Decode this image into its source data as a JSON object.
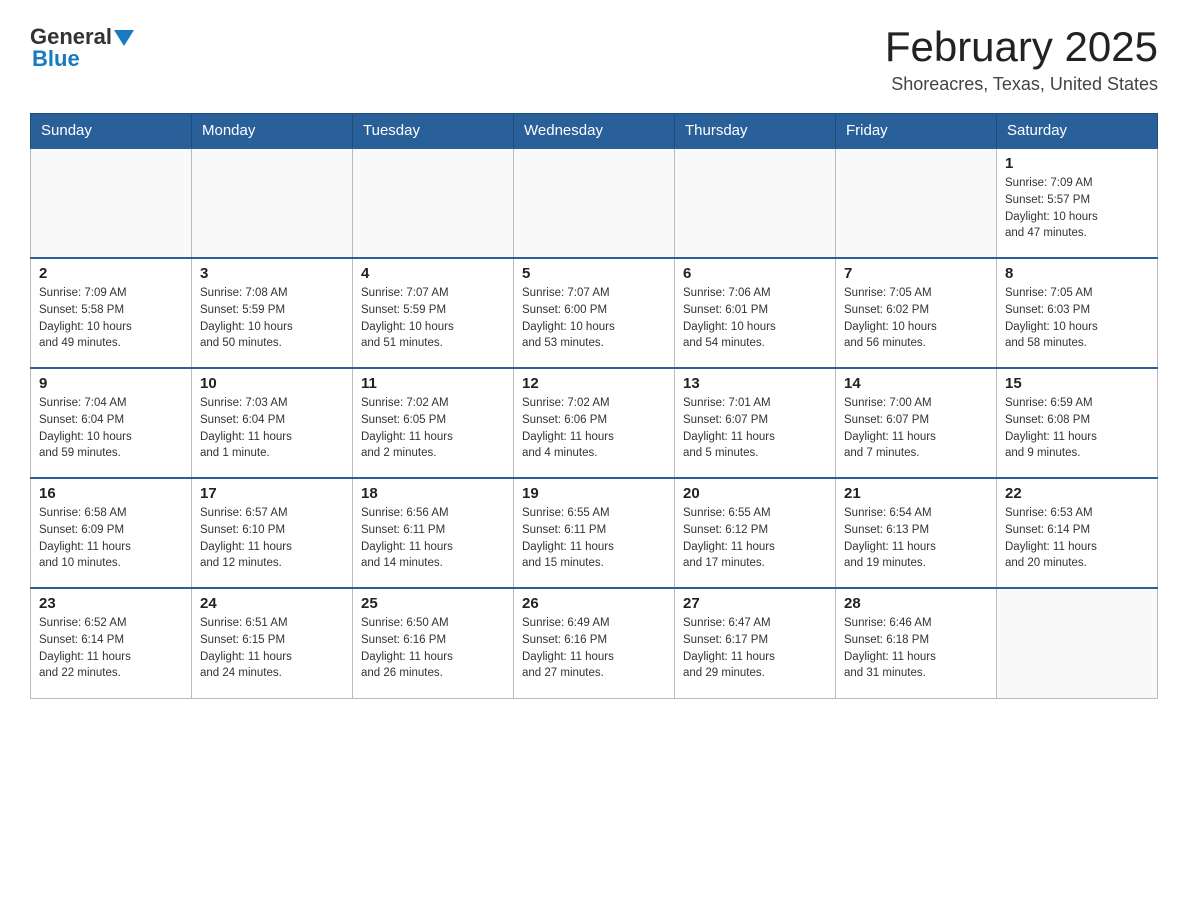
{
  "logo": {
    "text_general": "General",
    "text_blue": "Blue"
  },
  "header": {
    "title": "February 2025",
    "location": "Shoreacres, Texas, United States"
  },
  "weekdays": [
    "Sunday",
    "Monday",
    "Tuesday",
    "Wednesday",
    "Thursday",
    "Friday",
    "Saturday"
  ],
  "weeks": [
    [
      {
        "day": "",
        "info": ""
      },
      {
        "day": "",
        "info": ""
      },
      {
        "day": "",
        "info": ""
      },
      {
        "day": "",
        "info": ""
      },
      {
        "day": "",
        "info": ""
      },
      {
        "day": "",
        "info": ""
      },
      {
        "day": "1",
        "info": "Sunrise: 7:09 AM\nSunset: 5:57 PM\nDaylight: 10 hours\nand 47 minutes."
      }
    ],
    [
      {
        "day": "2",
        "info": "Sunrise: 7:09 AM\nSunset: 5:58 PM\nDaylight: 10 hours\nand 49 minutes."
      },
      {
        "day": "3",
        "info": "Sunrise: 7:08 AM\nSunset: 5:59 PM\nDaylight: 10 hours\nand 50 minutes."
      },
      {
        "day": "4",
        "info": "Sunrise: 7:07 AM\nSunset: 5:59 PM\nDaylight: 10 hours\nand 51 minutes."
      },
      {
        "day": "5",
        "info": "Sunrise: 7:07 AM\nSunset: 6:00 PM\nDaylight: 10 hours\nand 53 minutes."
      },
      {
        "day": "6",
        "info": "Sunrise: 7:06 AM\nSunset: 6:01 PM\nDaylight: 10 hours\nand 54 minutes."
      },
      {
        "day": "7",
        "info": "Sunrise: 7:05 AM\nSunset: 6:02 PM\nDaylight: 10 hours\nand 56 minutes."
      },
      {
        "day": "8",
        "info": "Sunrise: 7:05 AM\nSunset: 6:03 PM\nDaylight: 10 hours\nand 58 minutes."
      }
    ],
    [
      {
        "day": "9",
        "info": "Sunrise: 7:04 AM\nSunset: 6:04 PM\nDaylight: 10 hours\nand 59 minutes."
      },
      {
        "day": "10",
        "info": "Sunrise: 7:03 AM\nSunset: 6:04 PM\nDaylight: 11 hours\nand 1 minute."
      },
      {
        "day": "11",
        "info": "Sunrise: 7:02 AM\nSunset: 6:05 PM\nDaylight: 11 hours\nand 2 minutes."
      },
      {
        "day": "12",
        "info": "Sunrise: 7:02 AM\nSunset: 6:06 PM\nDaylight: 11 hours\nand 4 minutes."
      },
      {
        "day": "13",
        "info": "Sunrise: 7:01 AM\nSunset: 6:07 PM\nDaylight: 11 hours\nand 5 minutes."
      },
      {
        "day": "14",
        "info": "Sunrise: 7:00 AM\nSunset: 6:07 PM\nDaylight: 11 hours\nand 7 minutes."
      },
      {
        "day": "15",
        "info": "Sunrise: 6:59 AM\nSunset: 6:08 PM\nDaylight: 11 hours\nand 9 minutes."
      }
    ],
    [
      {
        "day": "16",
        "info": "Sunrise: 6:58 AM\nSunset: 6:09 PM\nDaylight: 11 hours\nand 10 minutes."
      },
      {
        "day": "17",
        "info": "Sunrise: 6:57 AM\nSunset: 6:10 PM\nDaylight: 11 hours\nand 12 minutes."
      },
      {
        "day": "18",
        "info": "Sunrise: 6:56 AM\nSunset: 6:11 PM\nDaylight: 11 hours\nand 14 minutes."
      },
      {
        "day": "19",
        "info": "Sunrise: 6:55 AM\nSunset: 6:11 PM\nDaylight: 11 hours\nand 15 minutes."
      },
      {
        "day": "20",
        "info": "Sunrise: 6:55 AM\nSunset: 6:12 PM\nDaylight: 11 hours\nand 17 minutes."
      },
      {
        "day": "21",
        "info": "Sunrise: 6:54 AM\nSunset: 6:13 PM\nDaylight: 11 hours\nand 19 minutes."
      },
      {
        "day": "22",
        "info": "Sunrise: 6:53 AM\nSunset: 6:14 PM\nDaylight: 11 hours\nand 20 minutes."
      }
    ],
    [
      {
        "day": "23",
        "info": "Sunrise: 6:52 AM\nSunset: 6:14 PM\nDaylight: 11 hours\nand 22 minutes."
      },
      {
        "day": "24",
        "info": "Sunrise: 6:51 AM\nSunset: 6:15 PM\nDaylight: 11 hours\nand 24 minutes."
      },
      {
        "day": "25",
        "info": "Sunrise: 6:50 AM\nSunset: 6:16 PM\nDaylight: 11 hours\nand 26 minutes."
      },
      {
        "day": "26",
        "info": "Sunrise: 6:49 AM\nSunset: 6:16 PM\nDaylight: 11 hours\nand 27 minutes."
      },
      {
        "day": "27",
        "info": "Sunrise: 6:47 AM\nSunset: 6:17 PM\nDaylight: 11 hours\nand 29 minutes."
      },
      {
        "day": "28",
        "info": "Sunrise: 6:46 AM\nSunset: 6:18 PM\nDaylight: 11 hours\nand 31 minutes."
      },
      {
        "day": "",
        "info": ""
      }
    ]
  ]
}
